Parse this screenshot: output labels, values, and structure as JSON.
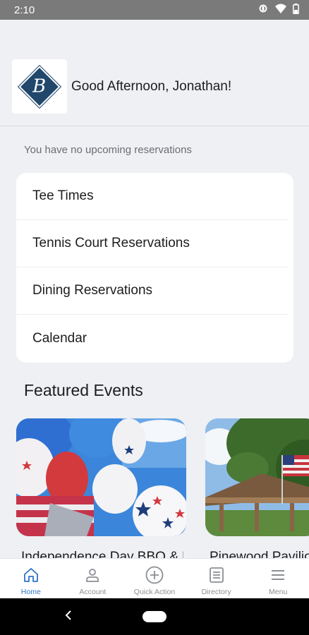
{
  "status_bar": {
    "time": "2:10"
  },
  "header": {
    "logo_letter": "B",
    "greeting": "Good Afternoon, Jonathan!"
  },
  "reservations": {
    "empty_text": "You have no upcoming reservations"
  },
  "menu": {
    "items": [
      {
        "label": "Tee Times"
      },
      {
        "label": "Tennis Court Reservations"
      },
      {
        "label": "Dining Reservations"
      },
      {
        "label": "Calendar"
      }
    ]
  },
  "featured": {
    "title": "Featured Events",
    "events": [
      {
        "title": "Independence Day BBQ & Fireworks",
        "image": "balloons-photo"
      },
      {
        "title": "Pinewood Pavilion Picnic",
        "image": "pavilion-flag-photo"
      }
    ]
  },
  "bottom_nav": {
    "items": [
      {
        "label": "Home",
        "icon": "home-icon",
        "active": true
      },
      {
        "label": "Account",
        "icon": "account-icon",
        "active": false
      },
      {
        "label": "Quick Action",
        "icon": "plus-circle-icon",
        "active": false
      },
      {
        "label": "Directory",
        "icon": "directory-icon",
        "active": false
      },
      {
        "label": "Menu",
        "icon": "hamburger-icon",
        "active": false
      }
    ]
  },
  "colors": {
    "accent": "#2f73c9",
    "brand_navy": "#21476b",
    "background": "#eef0f3"
  }
}
